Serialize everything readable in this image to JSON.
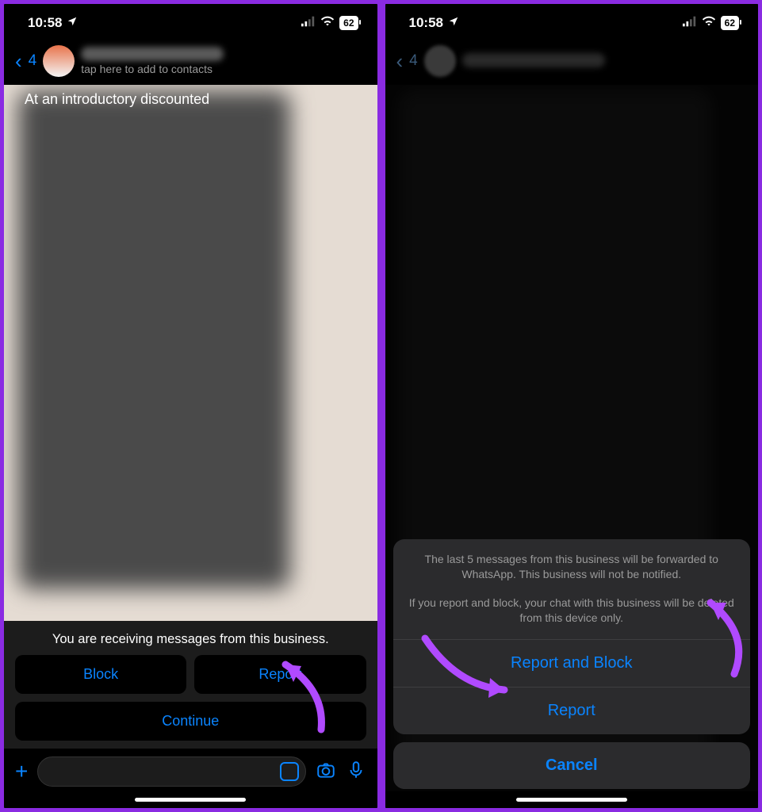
{
  "status": {
    "time": "10:58",
    "battery": "62"
  },
  "left": {
    "back_count": "4",
    "subtitle": "tap here to add to contacts",
    "intro": "At an introductory discounted",
    "business_msg": "You are receiving messages from this business.",
    "block": "Block",
    "report": "Report",
    "continue": "Continue"
  },
  "right": {
    "back_count": "4",
    "sheet_body1": "The last 5 messages from this business will be forwarded to WhatsApp. This business will not be notified.",
    "sheet_body2": "If you report and block, your chat with this business will be deleted from this device only.",
    "report_block": "Report and Block",
    "report": "Report",
    "cancel": "Cancel"
  }
}
